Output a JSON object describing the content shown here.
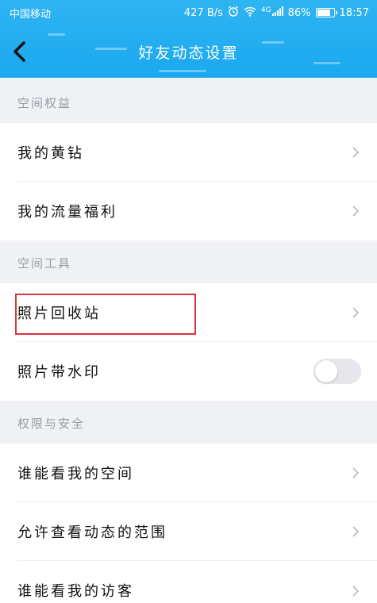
{
  "status_bar": {
    "carrier": "中国移动",
    "network_speed": "427 B/s",
    "network_type": "4G",
    "battery": "86%",
    "battery_level": 0.86,
    "time": "18:57"
  },
  "header": {
    "title": "好友动态设置"
  },
  "sections": [
    {
      "title": "空间权益",
      "items": [
        {
          "label": "我的黄钻"
        },
        {
          "label": "我的流量福利"
        }
      ]
    },
    {
      "title": "空间工具",
      "items": [
        {
          "label": "照片回收站"
        },
        {
          "label": "照片带水印",
          "toggle_on": false
        }
      ]
    },
    {
      "title": "权限与安全",
      "items": [
        {
          "label": "谁能看我的空间"
        },
        {
          "label": "允许查看动态的范围"
        },
        {
          "label": "谁能看我的访客"
        }
      ]
    }
  ],
  "colors": {
    "header": "#1ba8ef",
    "highlight": "#d9343c",
    "section_text": "#9a9ca6",
    "background": "#f0f1f5"
  }
}
